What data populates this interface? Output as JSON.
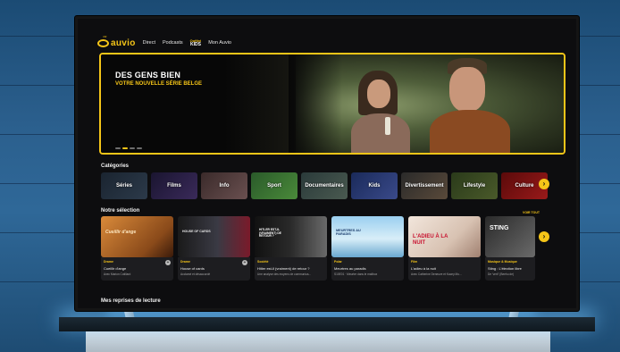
{
  "app": {
    "brand_small": "rtbf",
    "brand": "auvio"
  },
  "nav": {
    "items": [
      "Direct",
      "Podcasts"
    ],
    "kids_top": "Ouftivi",
    "kids_bottom": "KIDS",
    "mon_auvio": "Mon Auvio"
  },
  "hero": {
    "title": "DES GENS BIEN",
    "subtitle": "VOTRE NOUVELLE SÉRIE BELGE",
    "slides": 4,
    "active_slide": 2
  },
  "categories": {
    "heading": "Catégories",
    "items": [
      "Séries",
      "Films",
      "Info",
      "Sport",
      "Documentaires",
      "Kids",
      "Divertissement",
      "Lifestyle",
      "Culture"
    ]
  },
  "selection": {
    "heading": "Notre sélection",
    "see_all": "VOIR TOUT",
    "cards": [
      {
        "genre": "Drame",
        "title": "Cueillir d'ange",
        "desc": "Avec Marion Cotillard",
        "image_text": "Cueillir d'ange"
      },
      {
        "genre": "Drame",
        "title": "House of cards",
        "desc": "Acclamé et désaccordé",
        "image_text": "HOUSE OF CARDS"
      },
      {
        "genre": "Société",
        "title": "Hitler est-il (vraiment) de retour ?",
        "desc": "Une analyse des moyens de communica...",
        "image_text": "HITLER EST-IL (VRAIMENT) DE RETOUR ?"
      },
      {
        "genre": "Polar",
        "title": "Meurtres au paradis",
        "desc": "S10E01 · Meurtre dans le mailbox",
        "image_text": "MEURTRES AU PARADIS"
      },
      {
        "genre": "Film",
        "title": "L'adieu à la nuit",
        "desc": "Avec Catherine Deneuve et Kacey Mo...",
        "image_text": "L'ADIEU À LA NUIT"
      },
      {
        "genre": "Musique & Musique",
        "title": "Sting : L'élection libre",
        "desc": "De 'vert!' (Beehu de)",
        "image_text": "STING"
      }
    ]
  },
  "resume": {
    "heading": "Mes reprises de lecture"
  },
  "colors": {
    "accent": "#f5c518",
    "background": "#0d0d0f",
    "wall": "#2b5f8d"
  }
}
